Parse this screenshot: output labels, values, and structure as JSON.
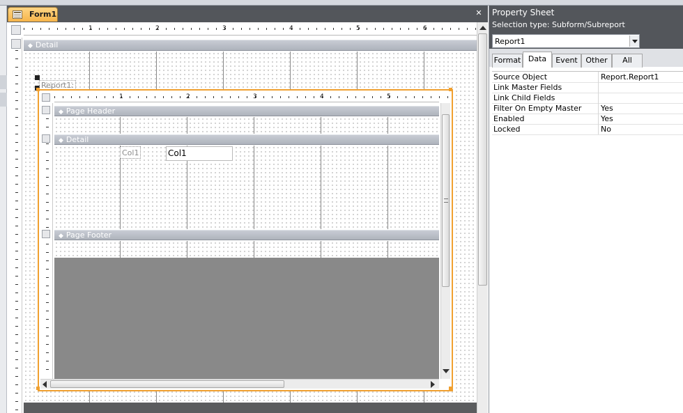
{
  "tab": {
    "title": "Form1",
    "close": "✕"
  },
  "outer": {
    "ruler": [
      "1",
      "2",
      "3",
      "4",
      "5",
      "6"
    ],
    "detail_label": "Detail",
    "subreport_label": "Report1:"
  },
  "sub": {
    "ruler": [
      "1",
      "2",
      "3",
      "4",
      "5"
    ],
    "page_header": "Page Header",
    "detail": "Detail",
    "page_footer": "Page Footer",
    "col_label": "Col1",
    "col_field": "Col1"
  },
  "props": {
    "title": "Property Sheet",
    "selection_type": "Selection type:  Subform/Subreport",
    "object_select": "Report1",
    "tabs": [
      "Format",
      "Data",
      "Event",
      "Other",
      "All"
    ],
    "active_tab": "Data",
    "rows": [
      {
        "key": "Source Object",
        "value": "Report.Report1"
      },
      {
        "key": "Link Master Fields",
        "value": ""
      },
      {
        "key": "Link Child Fields",
        "value": ""
      },
      {
        "key": "Filter On Empty Master",
        "value": "Yes"
      },
      {
        "key": "Enabled",
        "value": "Yes"
      },
      {
        "key": "Locked",
        "value": "No"
      }
    ]
  }
}
